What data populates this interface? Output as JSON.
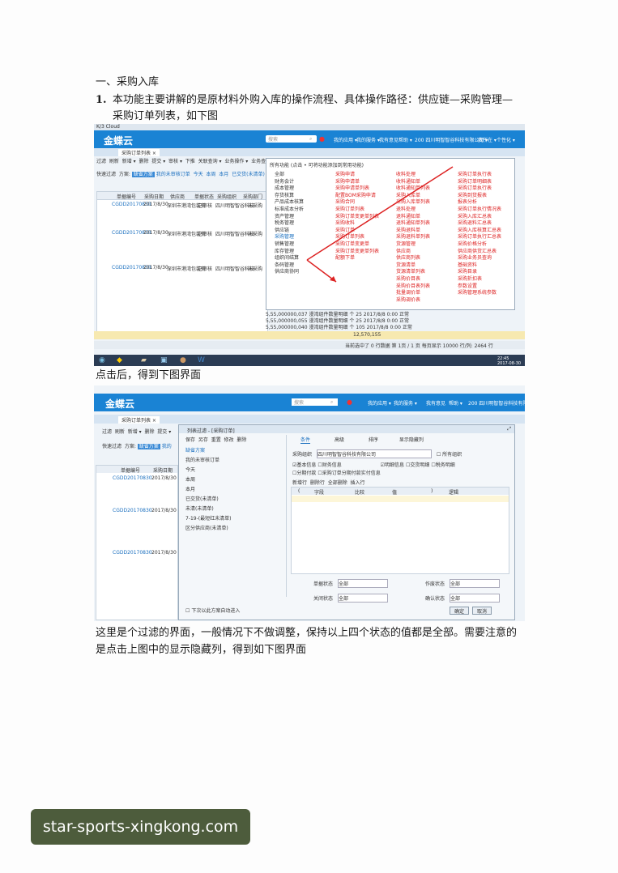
{
  "doc": {
    "heading": "一、采购入库",
    "step_num": "1.",
    "step_line1": "本功能主要讲解的是原材料外购入库的操作流程、具体操作路径：供应链—采购管理—",
    "step_line2": "采购订单列表，如下图",
    "after_click": "点击后，得到下图界面",
    "para_line1": "这里是个过滤的界面，一般情况下不做调整，保持以上四个状态的值都是全部。需要注意的",
    "para_line2": "是点击上图中的显示隐藏列，得到如下图界面"
  },
  "watermark": "star-sports-xingkong.com",
  "shot1": {
    "window_title": "K/3 Cloud",
    "logo": "金蝶云",
    "search_placeholder": "搜索",
    "header_links": [
      "我的应用 ▾",
      "我的服务 ▾",
      "我有意见",
      "帮助 ▾",
      "200  四川明智智谷科技有限公司 ▾",
      "我所在 ▾",
      "个性化 ▾"
    ],
    "tab_active": "采购订单列表 ×",
    "toolbar": [
      "过滤",
      "刷新",
      "新增 ▾",
      "删除",
      "提交 ▾",
      "审核 ▾",
      "下推",
      "关联查询 ▾",
      "业务操作 ▾",
      "业务查询 ▾"
    ],
    "filter_row": [
      "快速过滤",
      "方案:",
      "缺省方案",
      "我的未审核订单",
      "今天",
      "本周",
      "本月",
      "已交货(未清单)"
    ],
    "grid_headers": [
      "单据编号",
      "采购日期",
      "供应商",
      "单据状态",
      "采购组织",
      "采购部门"
    ],
    "grid_rows": [
      {
        "no": "CGDD20170830",
        "date": "2017/8/30",
        "supplier": "深圳市港湾包装有",
        "status": "已审核",
        "org": "四川明智智谷科技",
        "dept": "未采购"
      },
      {
        "no": "CGDD20170830",
        "date": "2017/8/30",
        "supplier": "深圳市港湾包装有",
        "status": "已审核",
        "org": "四川明智智谷科技",
        "dept": "未采购"
      },
      {
        "no": "CGDD20170830",
        "date": "2017/8/30",
        "supplier": "深圳市港湾包装有",
        "status": "已审核",
        "org": "四川明智智谷科技",
        "dept": "未采购"
      }
    ],
    "menu_title": "所有功能   (点击 • 可将功能添加到常用功能)",
    "menu_left": [
      "全部",
      "财务会计",
      "成本管理",
      "存货核算",
      "产品成本核算",
      "标准成本分析",
      "资产管理",
      "税务管理",
      "供应链",
      "采购管理",
      "销售管理",
      "库存管理",
      "组织间结算",
      "条码管理",
      "供应商协同"
    ],
    "menu_col1_title": "采购申请",
    "menu_col1": [
      "采购申请单",
      "采购申请单列表",
      "配置BOM采购申请",
      "采购合同",
      "采购订单列表",
      "采购订单变更单列表",
      "采购收料",
      "采购订单",
      "采购订单列表",
      "采购订单变更单",
      "采购订单变更单列表",
      "配额下单"
    ],
    "menu_col2_title": "收料处理",
    "menu_col2": [
      "收料通知单",
      "收料通知单列表",
      "采购入库单",
      "采购入库单列表",
      "退料处理",
      "退料通知单",
      "退料通知单列表",
      "采购退料单",
      "采购退料单列表",
      "货源管理",
      "供应商",
      "供应商列表",
      "货源清单",
      "货源清单列表",
      "采购价目表",
      "采购价目表列表",
      "批量调价单",
      "采购调价表"
    ],
    "menu_col3": [
      "采购订单执行表",
      "采购订单明细表",
      "采购订单执行表",
      "采购到货报表",
      "报表分析",
      "采购订单执行情况表",
      "采购入库汇总表",
      "采购退料汇总表",
      "采购入库核算汇总表",
      "采购订单执行汇总表",
      "采购价格分析",
      "供应商供货汇总表",
      "采购业务员查询",
      "基础资料",
      "采购目录",
      "采购折扣表",
      "参数设置",
      "采购管理系统参数"
    ],
    "bottom_rows": [
      "5,55,000000,037  漫湾组件数量明细 个  25  2017/8/8 0:00  正常",
      "5,55,000000,055  漫湾组件数量明细 个  25  2017/8/8 0:00  正常",
      "5,55,000000,040  漫湾组件数量明细 个  105  2017/8/8 0:00  正常"
    ],
    "total": "12,570,155",
    "status_bar": "当前选中了 0 行数据    第 1页 / 1 页    每页显示 10000    行/列: 2464 行",
    "clock": "22:45\n2017-08-30"
  },
  "shot2": {
    "logo": "金蝶云",
    "search_placeholder": "搜索",
    "header_links": [
      "我的应用 ▾",
      "我的服务 ▾",
      "我有意见",
      "帮助 ▾",
      "200  四川明智智谷科技有限公司"
    ],
    "tab_active": "采购订单列表 ×",
    "toolbar": [
      "过滤",
      "刷新",
      "新增 ▾",
      "删除",
      "提交 ▾"
    ],
    "filter_row": [
      "快速过滤",
      "方案:",
      "缺省方案",
      "我的"
    ],
    "dialog_title": "列表过滤 - [采购订单]",
    "dialog_toolbar": [
      "保存",
      "另存",
      "重置",
      "修改",
      "删除"
    ],
    "scheme_list": [
      "缺省方案",
      "我的未审核订单",
      "今天",
      "本周",
      "本月",
      "已交货(未清单)",
      "未清(未清单)",
      "7-19-(最短红未清单)",
      "区分供应商(未清单)"
    ],
    "dialog_tabs": [
      "条件",
      "高级",
      "排序",
      "显示隐藏列"
    ],
    "org_label": "采购组织",
    "org_value": "四川明智智谷科技有限公司",
    "all_org": "所有组织",
    "checkboxes_row1": [
      "基本信息",
      "财务信息",
      "明细信息",
      "交货明细",
      "税务明细"
    ],
    "checkboxes_row2": [
      "分期付款",
      "采购订单分期付款实付信息"
    ],
    "grid_toolbar": [
      "新增行",
      "删除行",
      "全部删除",
      "插入行"
    ],
    "grid_headers": [
      "(",
      "字段",
      "比较",
      "值",
      ")",
      "逻辑"
    ],
    "status_fields": [
      {
        "label": "单据状态",
        "value": "全部"
      },
      {
        "label": "作废状态",
        "value": "全部"
      },
      {
        "label": "关闭状态",
        "value": "全部"
      },
      {
        "label": "确认状态",
        "value": "全部"
      }
    ],
    "footer_note": "下次以此方案自动进入",
    "ok_button": "确定",
    "cancel_button": "取消",
    "list_rows": [
      {
        "no": "CGDD20170830",
        "date": "2017/8/30"
      },
      {
        "no": "CGDD20170830",
        "date": "2017/8/30"
      },
      {
        "no": "CGDD20170830",
        "date": "2017/8/30"
      }
    ],
    "list_headers": [
      "单据编号",
      "采购日期"
    ]
  }
}
